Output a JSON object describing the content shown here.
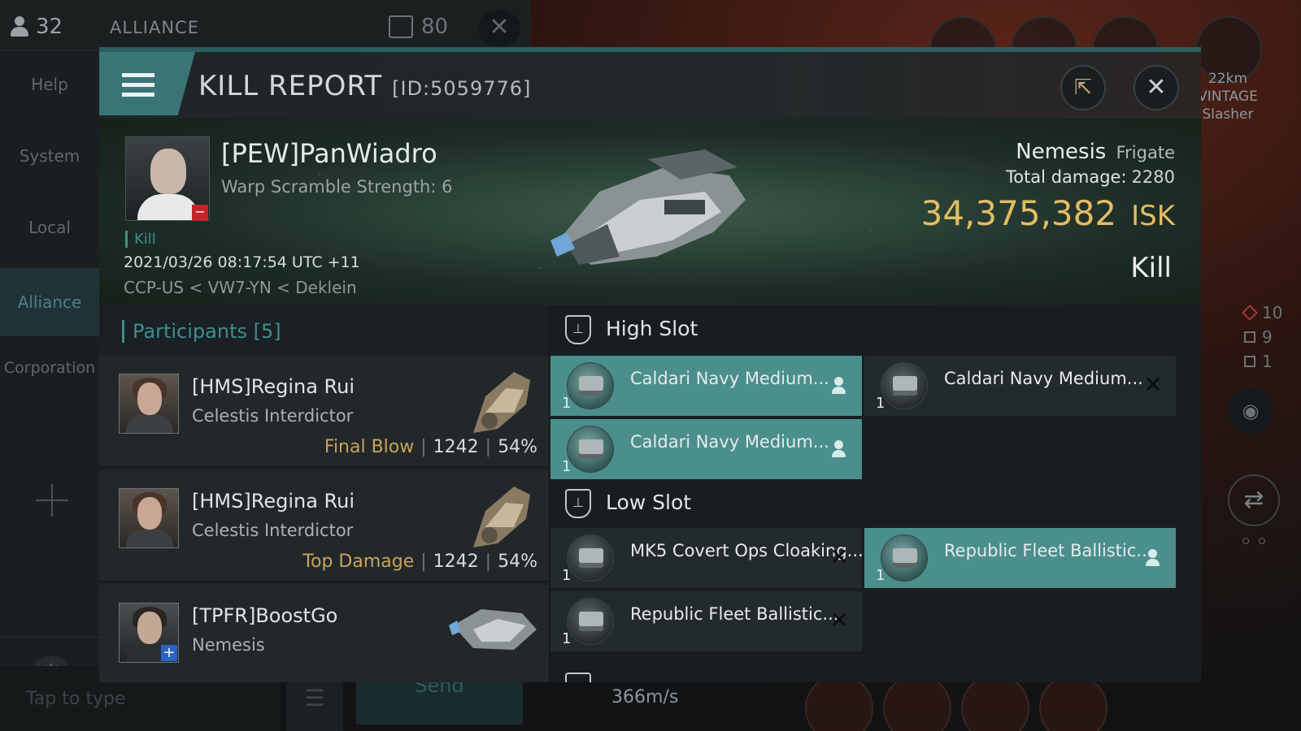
{
  "chat": {
    "pilot_count": "32",
    "channel_title": "ALLIANCE",
    "message_count": "80",
    "sidebar": [
      "Help",
      "System",
      "Local",
      "Alliance",
      "Corporation"
    ],
    "input_placeholder": "Tap to type",
    "send_label": "Send"
  },
  "hud": {
    "target_range": "22km",
    "target_line1": "VINTAGE",
    "target_line2": "Slasher",
    "stat_hostile": "10",
    "stat_fleet": "9",
    "stat_other": "1",
    "speed": "366m/s"
  },
  "report": {
    "title": "KILL REPORT",
    "id": "[ID:5059776]",
    "victim": {
      "name": "[PEW]PanWiadro",
      "scram": "Warp Scramble Strength: 6",
      "tag": "Kill",
      "time": "2021/03/26 08:17:54 UTC +11",
      "location": "CCP-US < VW7-YN < Deklein",
      "ship": "Nemesis",
      "ship_class": "Frigate",
      "total_damage_label": "Total damage:",
      "total_damage": "2280",
      "isk_value": "34,375,382",
      "isk_unit": "ISK",
      "result": "Kill"
    },
    "participants": {
      "title": "Participants [5]",
      "rows": [
        {
          "name": "[HMS]Regina Rui",
          "ship": "Celestis Interdictor",
          "role": "Final Blow",
          "damage": "1242",
          "percent": "54%"
        },
        {
          "name": "[HMS]Regina Rui",
          "ship": "Celestis Interdictor",
          "role": "Top Damage",
          "damage": "1242",
          "percent": "54%"
        },
        {
          "name": "[TPFR]BoostGo",
          "ship": "Nemesis",
          "role": "",
          "damage": "",
          "percent": ""
        }
      ]
    },
    "high_slot": {
      "title": "High Slot",
      "modules": [
        {
          "name": "Caldari Navy Medium...",
          "qty": "1",
          "state": "pilot"
        },
        {
          "name": "Caldari Navy Medium...",
          "qty": "1",
          "state": "destroyed"
        },
        {
          "name": "Caldari Navy Medium...",
          "qty": "1",
          "state": "pilot"
        }
      ]
    },
    "low_slot": {
      "title": "Low Slot",
      "modules": [
        {
          "name": "MK5 Covert Ops Cloaking...",
          "qty": "1",
          "state": "destroyed"
        },
        {
          "name": "Republic Fleet Ballistic...",
          "qty": "1",
          "state": "pilot"
        },
        {
          "name": "Republic Fleet Ballistic...",
          "qty": "1",
          "state": "destroyed"
        }
      ]
    }
  }
}
